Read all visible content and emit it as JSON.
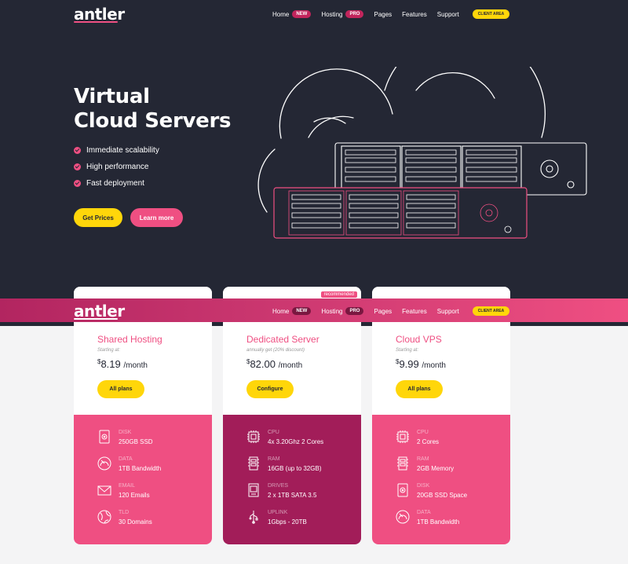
{
  "brand": {
    "logo": "antler"
  },
  "nav": {
    "home": "Home",
    "home_badge": "NEW",
    "hosting": "Hosting",
    "hosting_badge": "PRO",
    "pages": "Pages",
    "features": "Features",
    "support": "Support",
    "client_area": "CLIENT AREA"
  },
  "hero": {
    "title_line1": "Virtual",
    "title_line2": "Cloud Servers",
    "features": [
      "Immediate scalability",
      "High performance",
      "Fast deployment"
    ],
    "btn_prices": "Get Prices",
    "btn_learn": "Learn more"
  },
  "plans": [
    {
      "name": "Shared Hosting",
      "sub": "Starting at:",
      "currency": "$",
      "price": "8.19",
      "period": "/month",
      "button": "All plans",
      "specs": [
        {
          "label": "DISK",
          "value": "250GB SSD",
          "icon": "disk-icon"
        },
        {
          "label": "DATA",
          "value": "1TB Bandwidth",
          "icon": "gauge-icon"
        },
        {
          "label": "EMAIL",
          "value": "120 Emails",
          "icon": "envelope-icon"
        },
        {
          "label": "TLD",
          "value": "30 Domains",
          "icon": "globe-icon"
        }
      ]
    },
    {
      "name": "Dedicated Server",
      "sub": "annually get (20% discount)",
      "currency": "$",
      "price": "82.00",
      "period": "/month",
      "button": "Configure",
      "badge": "recommended",
      "specs": [
        {
          "label": "CPU",
          "value": "4x 3.20Ghz 2 Cores",
          "icon": "cpu-icon"
        },
        {
          "label": "RAM",
          "value": "16GB (up to 32GB)",
          "icon": "ram-icon"
        },
        {
          "label": "DRIVES",
          "value": "2 x 1TB SATA 3.5",
          "icon": "drive-icon"
        },
        {
          "label": "UPLINK",
          "value": "1Gbps - 20TB",
          "icon": "usb-icon"
        }
      ]
    },
    {
      "name": "Cloud VPS",
      "sub": "Starting at:",
      "currency": "$",
      "price": "9.99",
      "period": "/month",
      "button": "All plans",
      "specs": [
        {
          "label": "CPU",
          "value": "2 Cores",
          "icon": "cpu-icon"
        },
        {
          "label": "RAM",
          "value": "2GB Memory",
          "icon": "ram-icon"
        },
        {
          "label": "DISK",
          "value": "20GB SSD Space",
          "icon": "disk-icon"
        },
        {
          "label": "DATA",
          "value": "1TB Bandwidth",
          "icon": "gauge-icon"
        }
      ]
    }
  ],
  "colors": {
    "dark": "#242734",
    "pink": "#ef4f82",
    "magenta": "#a21d59",
    "yellow": "#ffd60a"
  }
}
